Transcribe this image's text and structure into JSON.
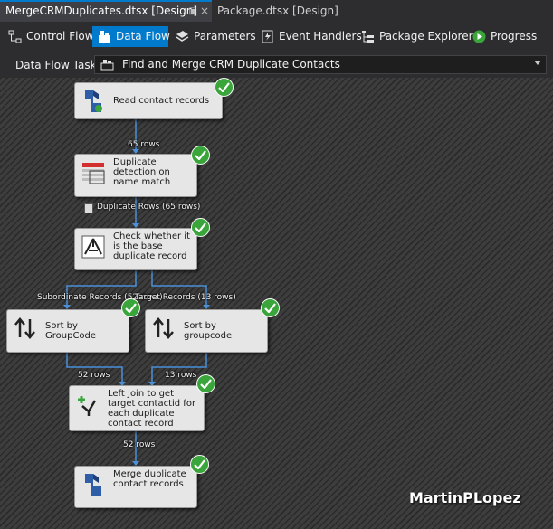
{
  "tabs": [
    {
      "label": "MergeCRMDuplicates.dtsx [Design]",
      "active": true
    },
    {
      "label": "Package.dtsx [Design]",
      "active": false
    }
  ],
  "tab_pin_icon": "pin-icon",
  "tab_close_glyph": "×",
  "toolbar": {
    "items": [
      {
        "label": "Control Flow",
        "icon": "control-flow-icon",
        "active": false
      },
      {
        "label": "Data Flow",
        "icon": "data-flow-icon",
        "active": true
      },
      {
        "label": "Parameters",
        "icon": "parameters-icon",
        "active": false
      },
      {
        "label": "Event Handlers",
        "icon": "event-handlers-icon",
        "active": false
      },
      {
        "label": "Package Explorer",
        "icon": "package-explorer-icon",
        "active": false
      },
      {
        "label": "Progress",
        "icon": "progress-icon",
        "active": false
      }
    ]
  },
  "task": {
    "label": "Data Flow Task:",
    "value": "Find and Merge CRM Duplicate Contacts",
    "icon": "data-flow-task-icon"
  },
  "components": [
    {
      "id": "read",
      "label": "Read contact records",
      "icon": "source-icon",
      "status": "success"
    },
    {
      "id": "dup",
      "label": "Duplicate detection on name match",
      "icon": "duplicate-detection-icon",
      "status": "success"
    },
    {
      "id": "check",
      "label": "Check whether it is the base duplicate record",
      "icon": "conditional-split-icon",
      "status": "success"
    },
    {
      "id": "sort1",
      "label": "Sort by GroupCode",
      "icon": "sort-icon",
      "status": "success"
    },
    {
      "id": "sort2",
      "label": "Sort by groupcode",
      "icon": "sort-icon",
      "status": "success"
    },
    {
      "id": "join",
      "label": "Left Join to get target contactid for each duplicate contact record",
      "icon": "merge-join-icon",
      "status": "success"
    },
    {
      "id": "merge",
      "label": "Merge duplicate contact records",
      "icon": "destination-icon",
      "status": "success"
    }
  ],
  "paths": [
    {
      "label": "65 rows"
    },
    {
      "label": "Duplicate Rows (65 rows)"
    },
    {
      "label": "Subordinate Records (52 rows)"
    },
    {
      "label": "Target Records (13 rows)"
    },
    {
      "label": "52 rows"
    },
    {
      "label": "13 rows"
    },
    {
      "label": "52 rows"
    }
  ],
  "watermark": "MartinPLopez",
  "colors": {
    "accent": "#007acc",
    "success": "#3aa53a",
    "wire": "#4a90d9"
  }
}
